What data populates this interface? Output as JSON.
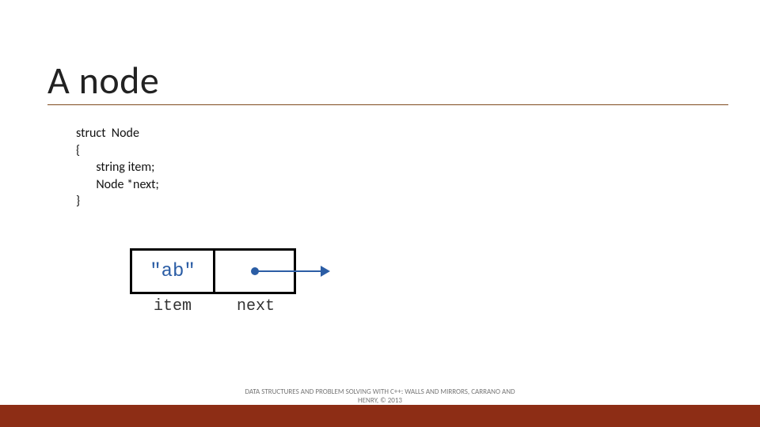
{
  "title": "A node",
  "code": {
    "l1": "struct  Node",
    "l2": "{",
    "l3": "       string item;",
    "l4": "       Node *next;",
    "l5": "}"
  },
  "diagram": {
    "item_value": "\"ab\"",
    "item_label": "item",
    "next_label": "next"
  },
  "footer": {
    "line1": "DATA STRUCTURES AND PROBLEM SOLVING WITH C++: WALLS AND MIRRORS, CARRANO AND",
    "line2": "HENRY, ©  2013"
  }
}
